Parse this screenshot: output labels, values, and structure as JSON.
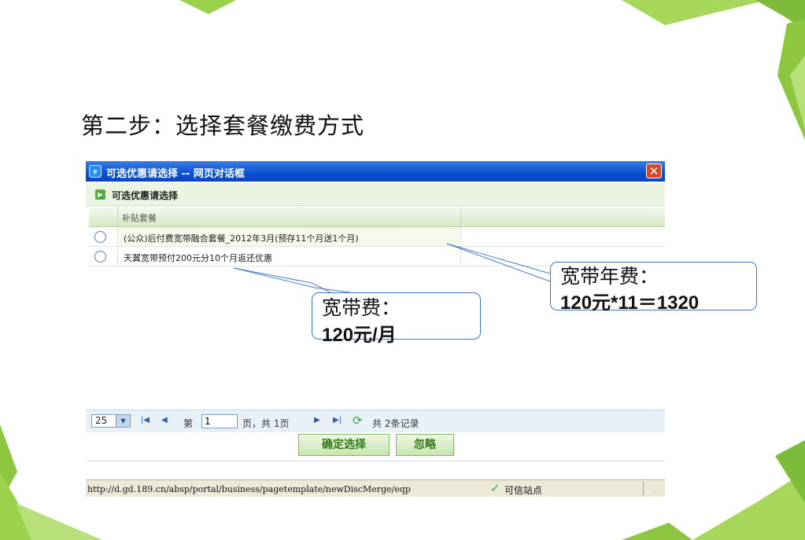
{
  "slide": {
    "step_title": "第二步：选择套餐缴费方式"
  },
  "dialog": {
    "title": "可选优惠请选择 -- 网页对话框",
    "close_glyph": "✕",
    "subheader": "可选优惠请选择",
    "table": {
      "column_header": "补贴套餐",
      "rows": [
        {
          "label": "(公众)后付费宽带融合套餐_2012年3月(预存11个月送1个月)"
        },
        {
          "label": "天翼宽带预付200元分10个月返还优惠"
        }
      ]
    },
    "pager": {
      "page_size": "25",
      "page_prefix": "第",
      "page_value": "1",
      "page_suffix": "页，共 1页",
      "records": "共 2条记录"
    },
    "buttons": {
      "confirm": "确定选择",
      "ignore": "忽略"
    },
    "status_bar": {
      "url": "http://d.gd.189.cn/absp/portal/business/pagetemplate/newDiscMerge/eqp",
      "trust": "可信站点"
    }
  },
  "callouts": [
    {
      "line1": "宽带费：",
      "line2": "120元/月"
    },
    {
      "line1": "宽带年费：",
      "line2": "120元*11＝1320"
    }
  ],
  "colors": {
    "titlebar": "#0b4fd0",
    "accent_green": "#4fae3f",
    "decoration_green": "#8dc63f",
    "callout_border": "#3c78c8"
  }
}
